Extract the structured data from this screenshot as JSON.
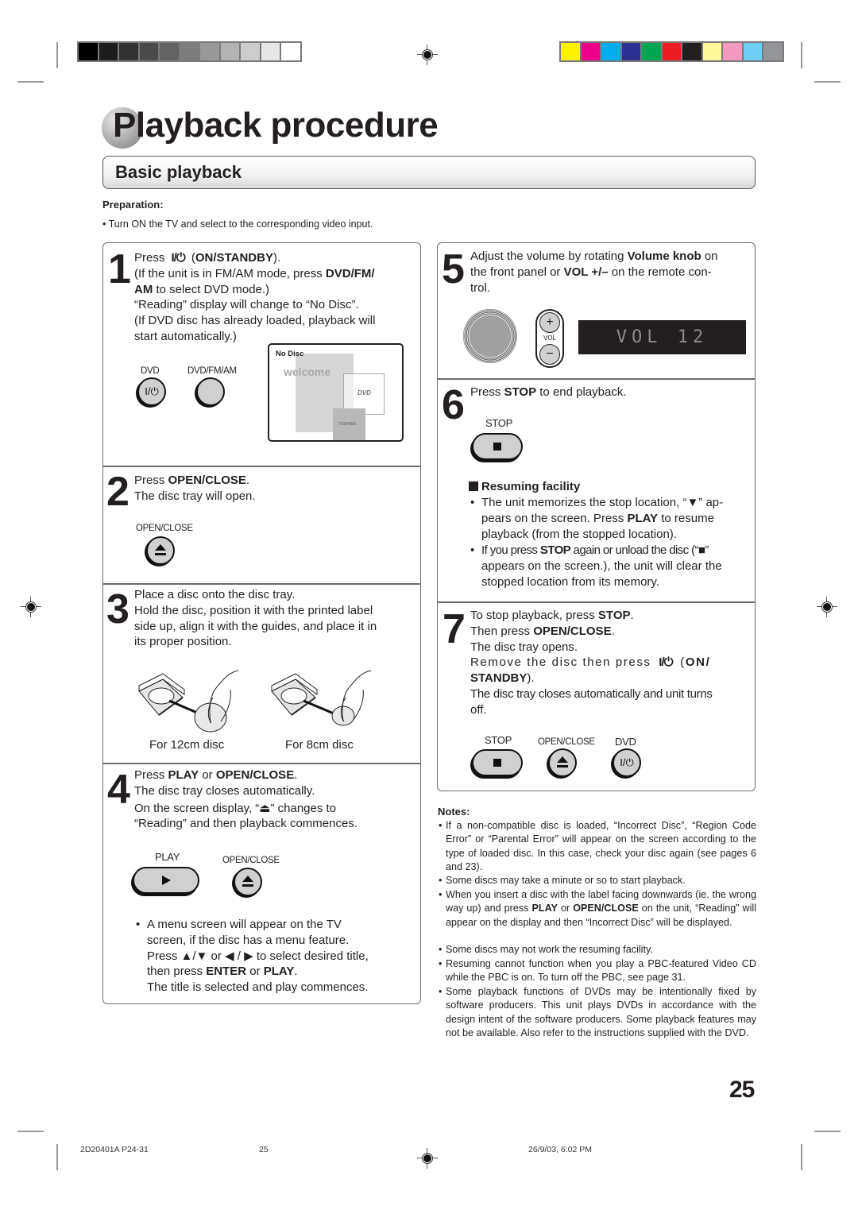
{
  "print_marks": {
    "grayscale_swatches": [
      "#000000",
      "#1c1c1c",
      "#333333",
      "#4a4a4a",
      "#636363",
      "#7d7d7d",
      "#999999",
      "#b3b3b3",
      "#cccccc",
      "#e6e6e6",
      "#ffffff"
    ],
    "color_swatches": [
      "#fff200",
      "#ec008c",
      "#00aeef",
      "#2e3192",
      "#00a651",
      "#ed1c24",
      "#231f20",
      "#fff799",
      "#f49ac1",
      "#6dcff6",
      "#939598"
    ]
  },
  "page": {
    "title_initial": "P",
    "title": "Playback procedure",
    "section_title": "Basic playback",
    "preparation_label": "Preparation:",
    "preparation_item": "Turn ON the TV and select to the corresponding video input.",
    "page_number": "25"
  },
  "steps": {
    "s1": {
      "number": "1",
      "l1a": "Press ",
      "power_symbol": "I/⏻",
      "l1b": " (",
      "l1c": "ON/STANDBY",
      "l1d": ").",
      "l2a": "(If the unit is in FM/AM mode, press ",
      "l2b": "DVD/FM/",
      "l3a": "AM",
      "l3b": " to select DVD mode.)",
      "l4": "“Reading” display will change to “No Disc”.",
      "l5": "(If DVD disc has already loaded, playback will",
      "l6": "start automatically.)",
      "btn_dvd_label": "DVD",
      "btn_dvd_glyph": "I/⏻",
      "btn_dvdfmam_label": "DVD/FM/AM",
      "screen_status": "No Disc",
      "screen_welcome": "welcome",
      "screen_dvd_logo": "DVD",
      "screen_brand": "TOSHIBA"
    },
    "s2": {
      "number": "2",
      "l1a": "Press ",
      "l1b": "OPEN/CLOSE",
      "l1c": ".",
      "l2": "The disc tray will open.",
      "btn_label": "OPEN/CLOSE"
    },
    "s3": {
      "number": "3",
      "l1": "Place a disc onto the disc tray.",
      "l2": "Hold the disc, position it with the printed label",
      "l3": "side up, align it with the guides, and place it in",
      "l4": "its proper position.",
      "caption_12cm": "For 12cm disc",
      "caption_8cm": "For 8cm disc"
    },
    "s4": {
      "number": "4",
      "l1a": "Press ",
      "l1b": "PLAY",
      "l1c": " or ",
      "l1d": "OPEN/CLOSE",
      "l1e": ".",
      "l2": "The disc tray closes automatically.",
      "l3a": "On the screen display, “",
      "l3_icon": "⏏",
      "l3b": "” changes to",
      "l4": "“Reading” and then playback commences.",
      "btn_play_label": "PLAY",
      "btn_openclose_label": "OPEN/CLOSE",
      "bullet_l1": "A menu screen will appear on the TV",
      "bullet_l2": "screen, if the disc has a menu feature.",
      "bullet_l3a": "Press ",
      "bullet_l3_arrows1": "▲/▼",
      "bullet_l3b": " or ",
      "bullet_l3_arrows2": "◀ / ▶",
      "bullet_l3c": "to select desired title,",
      "bullet_l4a": "then press ",
      "bullet_l4b": "ENTER",
      "bullet_l4c": " or ",
      "bullet_l4d": "PLAY",
      "bullet_l4e": ".",
      "bullet_l5": "The title is selected and play commences."
    },
    "s5": {
      "number": "5",
      "l1a": "Adjust the volume by rotating ",
      "l1b": "Volume knob",
      "l1c": " on",
      "l2a": "the front panel or ",
      "l2b": "VOL +/–",
      "l2c": " on the remote con-",
      "l3": "trol.",
      "vol_plus": "+",
      "vol_label": "VOL",
      "vol_minus": "−",
      "lcd_text": "VOL 12"
    },
    "s6": {
      "number": "6",
      "l1a": "Press ",
      "l1b": "STOP",
      "l1c": " to end playback.",
      "btn_label": "STOP",
      "resume_heading": "Resuming facility",
      "r1_l1": "The unit memorizes the stop location, “▼” ap-",
      "r1_l2a": "pears on the screen. Press ",
      "r1_l2b": "PLAY",
      "r1_l2c": " to resume",
      "r1_l3": "playback (from the stopped location).",
      "r2_l1a": "If you press ",
      "r2_l1b": "STOP",
      "r2_l1c": " again or unload the disc (“■”",
      "r2_l2": "appears on the screen.), the unit will clear the",
      "r2_l3": "stopped location from its memory."
    },
    "s7": {
      "number": "7",
      "l1a": "To stop playback, press ",
      "l1b": "STOP",
      "l1c": ".",
      "l2a": "Then press ",
      "l2b": "OPEN/CLOSE",
      "l2c": ".",
      "l3": "The disc tray opens.",
      "l4a": "Remove the disc then press ",
      "l4_symbol": "I/⏻",
      "l4b": " (",
      "l4c": "ON/",
      "l5a": "STANDBY",
      "l5b": ").",
      "l6": "The disc tray closes automatically and unit turns",
      "l7": "off.",
      "btn_stop_label": "STOP",
      "btn_openclose_label": "OPEN/CLOSE",
      "btn_dvd_label": "DVD",
      "btn_dvd_glyph": "I/⏻"
    }
  },
  "notes": {
    "label": "Notes:",
    "n1": "If a non-compatible disc is loaded, “Incorrect Disc”, “Region Code Error” or “Parental Error” will appear on the screen according to the type of loaded disc. In this case, check your disc again (see pages 6 and 23).",
    "n2": "Some discs may take a minute or so to start playback.",
    "n3a": "When you insert a disc with the label facing downwards (ie. the wrong way up) and press ",
    "n3b": "PLAY",
    "n3c": " or ",
    "n3d": "OPEN/CLOSE",
    "n3e": " on the unit, “Reading” will appear on the display and then “Incorrect Disc” will be displayed.",
    "n4": "Some discs may not work the resuming facility.",
    "n5": "Resuming cannot function when you play a PBC-featured Video CD while the PBC is on. To turn off the PBC, see page 31.",
    "n6": "Some playback functions of DVDs may be intentionally fixed by software producers. This unit plays DVDs in accordance with the design intent of the software producers. Some playback features may not be available. Also refer to the instructions supplied with the DVD."
  },
  "footer": {
    "file": "2D20401A P24-31",
    "page": "25",
    "timestamp": "26/9/03, 6:02 PM"
  }
}
